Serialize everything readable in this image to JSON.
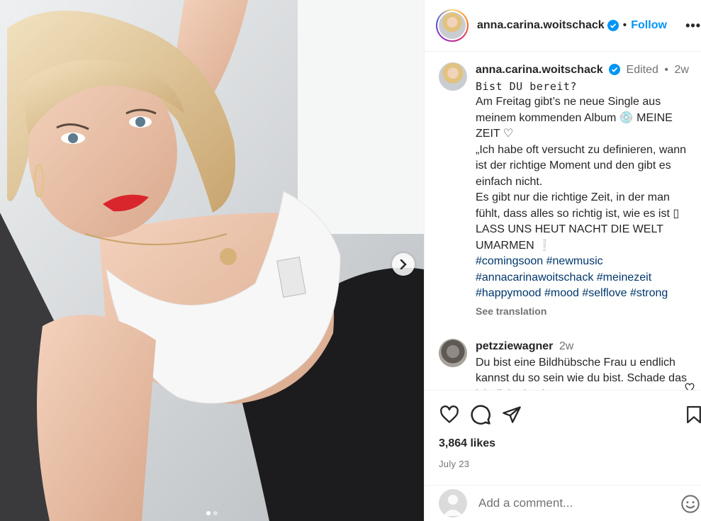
{
  "post": {
    "username": "anna.carina.woitschack",
    "follow_label": "Follow",
    "separator": "•",
    "more_label": "•••"
  },
  "caption": {
    "username": "anna.carina.woitschack",
    "edited": "Edited",
    "time": "2w",
    "lines": [
      "Bist DU bereit?",
      "Am Freitag gibt’s ne neue Single aus meinem kommenden Album 💿 MEINE ZEIT ♡",
      "„Ich habe oft versucht zu definieren, wann ist der richtige Moment und den gibt es einfach nicht.",
      "Es gibt nur die richtige Zeit, in der man fühlt, dass alles so richtig ist, wie es ist ▯ LASS UNS HEUT NACHT DIE WELT UMARMEN ❕"
    ],
    "hashtags": [
      "#comingsoon",
      "#newmusic",
      "#annacarinawoitschack",
      "#meinezeit",
      "#happymood",
      "#mood",
      "#selflove",
      "#strong"
    ],
    "see_translation": "See translation"
  },
  "comment": {
    "username": "petzziewagner",
    "time": "2w",
    "text": "Du bist eine Bildhübsche Frau u endlich kannst du so sein wie du bist. Schade das ich dich nie Live"
  },
  "stats": {
    "likes": "3,864 likes",
    "date": "July 23"
  },
  "add_comment": {
    "placeholder": "Add a comment..."
  },
  "carousel": {
    "current": 1,
    "total": 2
  },
  "icons": {
    "verified": "verified-badge-icon",
    "like": "heart-icon",
    "comment": "comment-icon",
    "share": "paper-plane-icon",
    "save": "bookmark-icon",
    "emoji": "emoji-icon",
    "next": "chevron-right-icon"
  },
  "colors": {
    "link": "#0095f6",
    "hashtag": "#00376b",
    "meta": "#737373"
  }
}
